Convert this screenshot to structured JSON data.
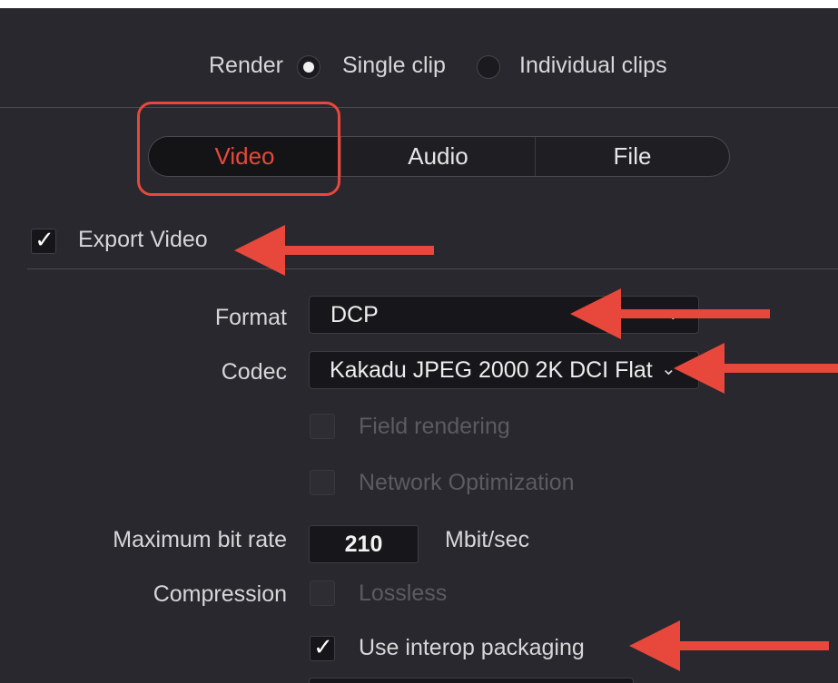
{
  "render": {
    "label": "Render",
    "options": [
      {
        "label": "Single clip",
        "selected": true
      },
      {
        "label": "Individual clips",
        "selected": false
      }
    ]
  },
  "tabs": [
    {
      "label": "Video",
      "active": true
    },
    {
      "label": "Audio",
      "active": false
    },
    {
      "label": "File",
      "active": false
    }
  ],
  "export_video": {
    "label": "Export Video",
    "checked": true
  },
  "format": {
    "label": "Format",
    "value": "DCP"
  },
  "codec": {
    "label": "Codec",
    "value": "Kakadu JPEG 2000 2K DCI Flat"
  },
  "field_rendering": {
    "label": "Field rendering",
    "checked": false
  },
  "network_optimization": {
    "label": "Network Optimization",
    "checked": false
  },
  "max_bit_rate": {
    "label": "Maximum bit rate",
    "value": "210",
    "unit": "Mbit/sec"
  },
  "compression": {
    "label": "Compression",
    "option_label": "Lossless",
    "checked": false
  },
  "interop": {
    "label": "Use interop packaging",
    "checked": true
  },
  "colors": {
    "accent": "#e8483b",
    "panel": "#28282e",
    "text": "#d7d7d9",
    "disabled": "#5b5b61"
  },
  "icons": {
    "check": "checkmark-icon",
    "chevron": "chevron-down-icon",
    "arrow": "arrow-left-annotation"
  }
}
